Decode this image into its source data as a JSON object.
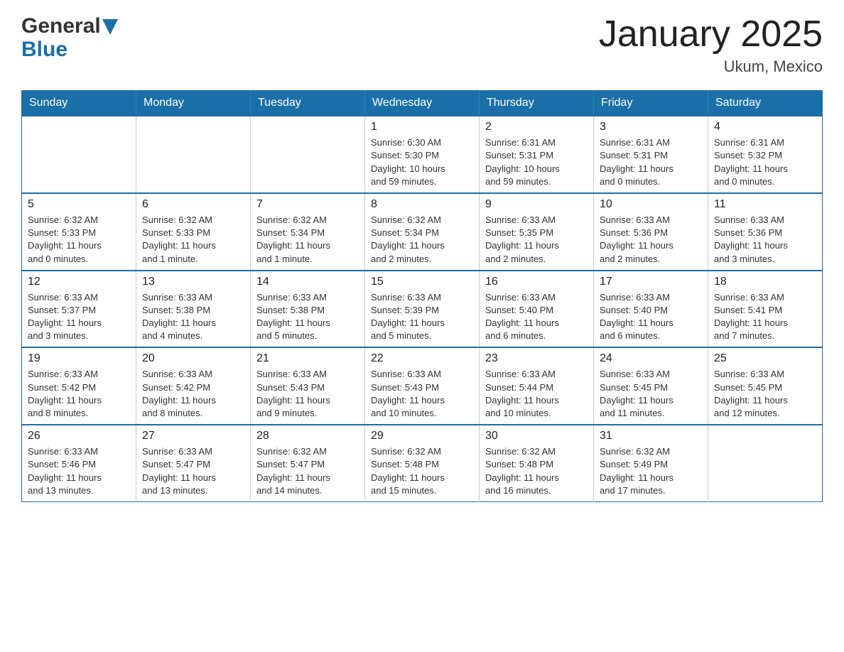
{
  "header": {
    "logo_general": "General",
    "logo_blue": "Blue",
    "title": "January 2025",
    "location": "Ukum, Mexico"
  },
  "calendar": {
    "days_of_week": [
      "Sunday",
      "Monday",
      "Tuesday",
      "Wednesday",
      "Thursday",
      "Friday",
      "Saturday"
    ],
    "weeks": [
      [
        {
          "day": "",
          "info": ""
        },
        {
          "day": "",
          "info": ""
        },
        {
          "day": "",
          "info": ""
        },
        {
          "day": "1",
          "info": "Sunrise: 6:30 AM\nSunset: 5:30 PM\nDaylight: 10 hours\nand 59 minutes."
        },
        {
          "day": "2",
          "info": "Sunrise: 6:31 AM\nSunset: 5:31 PM\nDaylight: 10 hours\nand 59 minutes."
        },
        {
          "day": "3",
          "info": "Sunrise: 6:31 AM\nSunset: 5:31 PM\nDaylight: 11 hours\nand 0 minutes."
        },
        {
          "day": "4",
          "info": "Sunrise: 6:31 AM\nSunset: 5:32 PM\nDaylight: 11 hours\nand 0 minutes."
        }
      ],
      [
        {
          "day": "5",
          "info": "Sunrise: 6:32 AM\nSunset: 5:33 PM\nDaylight: 11 hours\nand 0 minutes."
        },
        {
          "day": "6",
          "info": "Sunrise: 6:32 AM\nSunset: 5:33 PM\nDaylight: 11 hours\nand 1 minute."
        },
        {
          "day": "7",
          "info": "Sunrise: 6:32 AM\nSunset: 5:34 PM\nDaylight: 11 hours\nand 1 minute."
        },
        {
          "day": "8",
          "info": "Sunrise: 6:32 AM\nSunset: 5:34 PM\nDaylight: 11 hours\nand 2 minutes."
        },
        {
          "day": "9",
          "info": "Sunrise: 6:33 AM\nSunset: 5:35 PM\nDaylight: 11 hours\nand 2 minutes."
        },
        {
          "day": "10",
          "info": "Sunrise: 6:33 AM\nSunset: 5:36 PM\nDaylight: 11 hours\nand 2 minutes."
        },
        {
          "day": "11",
          "info": "Sunrise: 6:33 AM\nSunset: 5:36 PM\nDaylight: 11 hours\nand 3 minutes."
        }
      ],
      [
        {
          "day": "12",
          "info": "Sunrise: 6:33 AM\nSunset: 5:37 PM\nDaylight: 11 hours\nand 3 minutes."
        },
        {
          "day": "13",
          "info": "Sunrise: 6:33 AM\nSunset: 5:38 PM\nDaylight: 11 hours\nand 4 minutes."
        },
        {
          "day": "14",
          "info": "Sunrise: 6:33 AM\nSunset: 5:38 PM\nDaylight: 11 hours\nand 5 minutes."
        },
        {
          "day": "15",
          "info": "Sunrise: 6:33 AM\nSunset: 5:39 PM\nDaylight: 11 hours\nand 5 minutes."
        },
        {
          "day": "16",
          "info": "Sunrise: 6:33 AM\nSunset: 5:40 PM\nDaylight: 11 hours\nand 6 minutes."
        },
        {
          "day": "17",
          "info": "Sunrise: 6:33 AM\nSunset: 5:40 PM\nDaylight: 11 hours\nand 6 minutes."
        },
        {
          "day": "18",
          "info": "Sunrise: 6:33 AM\nSunset: 5:41 PM\nDaylight: 11 hours\nand 7 minutes."
        }
      ],
      [
        {
          "day": "19",
          "info": "Sunrise: 6:33 AM\nSunset: 5:42 PM\nDaylight: 11 hours\nand 8 minutes."
        },
        {
          "day": "20",
          "info": "Sunrise: 6:33 AM\nSunset: 5:42 PM\nDaylight: 11 hours\nand 8 minutes."
        },
        {
          "day": "21",
          "info": "Sunrise: 6:33 AM\nSunset: 5:43 PM\nDaylight: 11 hours\nand 9 minutes."
        },
        {
          "day": "22",
          "info": "Sunrise: 6:33 AM\nSunset: 5:43 PM\nDaylight: 11 hours\nand 10 minutes."
        },
        {
          "day": "23",
          "info": "Sunrise: 6:33 AM\nSunset: 5:44 PM\nDaylight: 11 hours\nand 10 minutes."
        },
        {
          "day": "24",
          "info": "Sunrise: 6:33 AM\nSunset: 5:45 PM\nDaylight: 11 hours\nand 11 minutes."
        },
        {
          "day": "25",
          "info": "Sunrise: 6:33 AM\nSunset: 5:45 PM\nDaylight: 11 hours\nand 12 minutes."
        }
      ],
      [
        {
          "day": "26",
          "info": "Sunrise: 6:33 AM\nSunset: 5:46 PM\nDaylight: 11 hours\nand 13 minutes."
        },
        {
          "day": "27",
          "info": "Sunrise: 6:33 AM\nSunset: 5:47 PM\nDaylight: 11 hours\nand 13 minutes."
        },
        {
          "day": "28",
          "info": "Sunrise: 6:32 AM\nSunset: 5:47 PM\nDaylight: 11 hours\nand 14 minutes."
        },
        {
          "day": "29",
          "info": "Sunrise: 6:32 AM\nSunset: 5:48 PM\nDaylight: 11 hours\nand 15 minutes."
        },
        {
          "day": "30",
          "info": "Sunrise: 6:32 AM\nSunset: 5:48 PM\nDaylight: 11 hours\nand 16 minutes."
        },
        {
          "day": "31",
          "info": "Sunrise: 6:32 AM\nSunset: 5:49 PM\nDaylight: 11 hours\nand 17 minutes."
        },
        {
          "day": "",
          "info": ""
        }
      ]
    ]
  }
}
